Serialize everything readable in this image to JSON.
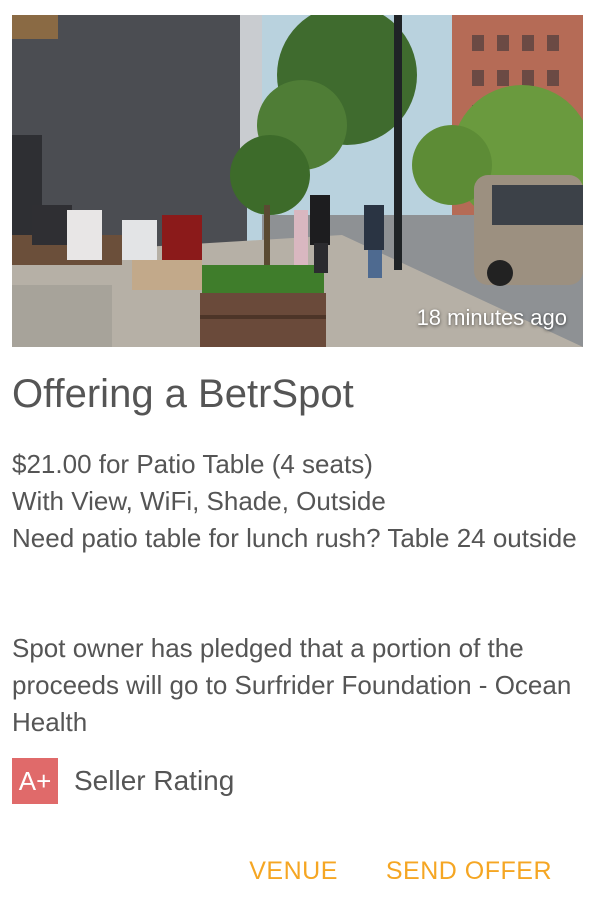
{
  "listing": {
    "timestamp": "18 minutes ago",
    "title": "Offering a BetrSpot",
    "price_line": "$21.00 for Patio Table (4 seats)",
    "amenities_line": "With View, WiFi, Shade, Outside",
    "description": "Need patio table for lunch rush? Table 24 outside",
    "pledge": "Spot owner has pledged that a portion of the proceeds will go to Surfrider Foundation - Ocean Health"
  },
  "seller": {
    "grade": "A+",
    "rating_label": "Seller Rating"
  },
  "actions": {
    "venue_label": "VENUE",
    "send_offer_label": "SEND OFFER"
  },
  "colors": {
    "accent": "#f5a623",
    "badge": "#e06a6a",
    "text": "#555555"
  }
}
